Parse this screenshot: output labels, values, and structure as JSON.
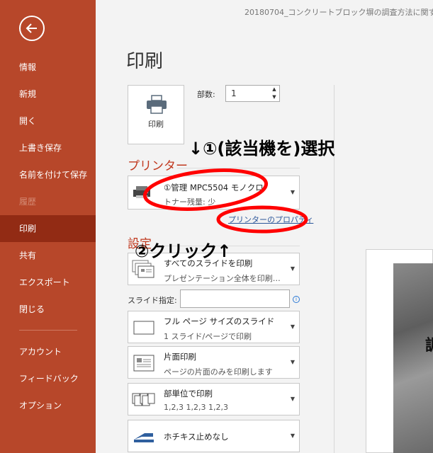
{
  "sidebar": {
    "items": [
      {
        "label": "情報"
      },
      {
        "label": "新規"
      },
      {
        "label": "開く"
      },
      {
        "label": "上書き保存"
      },
      {
        "label": "名前を付けて保存"
      },
      {
        "label": "履歴"
      },
      {
        "label": "印刷"
      },
      {
        "label": "共有"
      },
      {
        "label": "エクスポート"
      },
      {
        "label": "閉じる"
      },
      {
        "label": "アカウント"
      },
      {
        "label": "フィードバック"
      },
      {
        "label": "オプション"
      }
    ]
  },
  "window": {
    "doc_title": "20180704_コンクリートブロック塀の調査方法に関する資"
  },
  "page": {
    "title": "印刷"
  },
  "print_button": {
    "label": "印刷"
  },
  "copies": {
    "label": "部数:",
    "value": "1"
  },
  "printer": {
    "section_title": "プリンター",
    "name": "①管理 MPC5504 モノクロ",
    "status": "トナー残量: 少",
    "properties_link": "プリンターのプロパティ"
  },
  "settings": {
    "section_title": "設定",
    "slides_label": "スライド指定:",
    "slides_value": "",
    "info_icon": "i",
    "dropdowns": [
      {
        "line1": "すべてのスライドを印刷",
        "line2": "プレゼンテーション全体を印刷…",
        "icon": "pages-icon"
      },
      {
        "line1": "フル ページ サイズのスライド",
        "line2": "1 スライド/ページで印刷",
        "icon": "slide-icon"
      },
      {
        "line1": "片面印刷",
        "line2": "ページの片面のみを印刷します",
        "icon": "one-sided-icon"
      },
      {
        "line1": "部単位で印刷",
        "line2": "1,2,3   1,2,3   1,2,3",
        "icon": "collate-icon"
      },
      {
        "line1": "ホチキス止めなし",
        "line2": "",
        "icon": "staple-icon"
      }
    ]
  },
  "annotations": {
    "step1": "↓①(該当機を)選択",
    "step2": "②クリック↑"
  },
  "preview": {
    "text": "調"
  },
  "colors": {
    "sidebar": "#b7472a",
    "sidebar_active": "#922b14",
    "accent_title": "#c0391f",
    "link": "#2b579a",
    "annotation": "#ff0000"
  }
}
